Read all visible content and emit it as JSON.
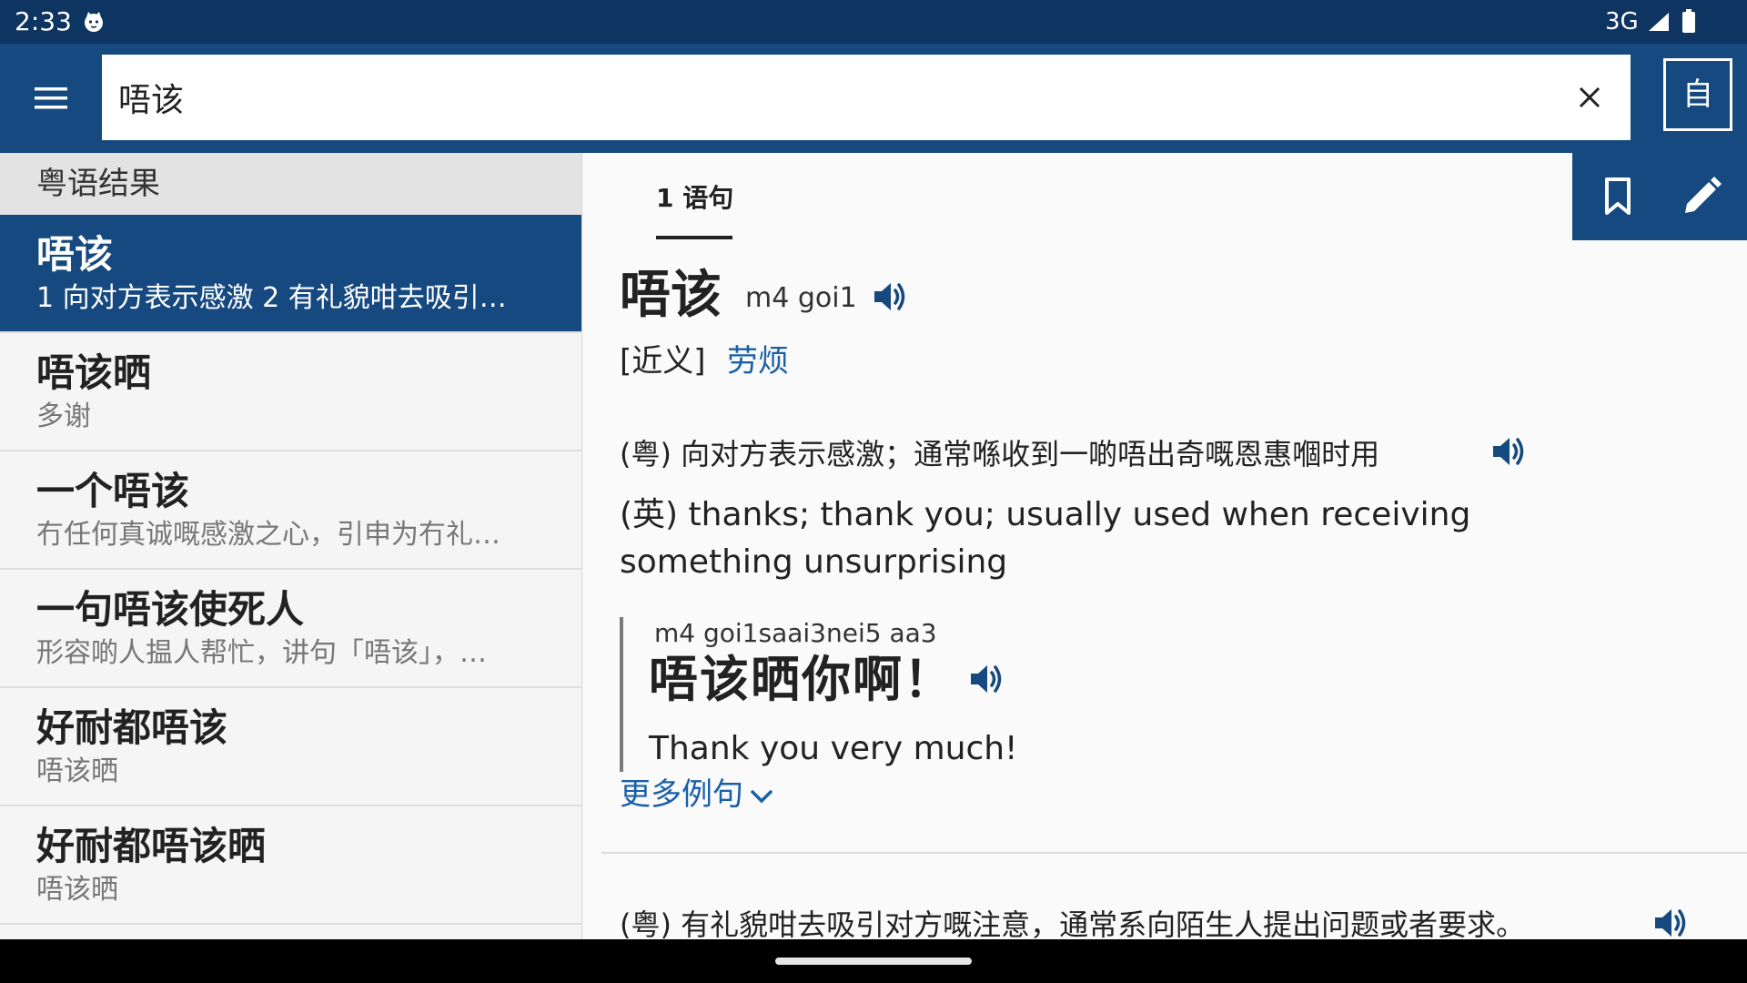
{
  "status_bar": {
    "time": "2:33",
    "network": "3G",
    "app_icon": "cat-face-icon",
    "signal_icon": "signal-icon",
    "battery_icon": "battery-icon"
  },
  "app_bar": {
    "menu_icon": "hamburger-menu-icon",
    "search_value": "唔该",
    "clear_icon": "close-icon",
    "mode_label": "自",
    "accent_color": "#15497f"
  },
  "results": {
    "header": "粤语结果",
    "items": [
      {
        "word": "唔该",
        "desc": "1 向对方表示感激 2 有礼貌咁去吸引…",
        "selected": true
      },
      {
        "word": "唔该晒",
        "desc": "多谢"
      },
      {
        "word": "一个唔该",
        "desc": "冇任何真诚嘅感激之心，引申为冇礼…"
      },
      {
        "word": "一句唔该使死人",
        "desc": "形容啲人揾人帮忙，讲句「唔该」，…"
      },
      {
        "word": "好耐都唔该",
        "desc": "唔该晒"
      },
      {
        "word": "好耐都唔该晒",
        "desc": "唔该晒"
      }
    ]
  },
  "entry": {
    "tab_label": "1 语句",
    "headword": "唔该",
    "jyutping": "m4 goi1",
    "synonym_label": "[近义]",
    "synonym": "劳烦",
    "definition_1": {
      "yue": "(粤) 向对方表示感激；通常喺收到一啲唔出奇嘅恩惠嗰时用",
      "eng": "(英) thanks; thank you; usually used when receiving something unsurprising"
    },
    "example": {
      "jyutping": "m4 goi1saai3nei5 aa3",
      "sentence": "唔该晒你啊！",
      "translation": "Thank you very much!"
    },
    "more_examples": "更多例句",
    "definition_2": {
      "yue": "(粤) 有礼貌咁去吸引对方嘅注意，通常系向陌生人提出问题或者要求。"
    },
    "link_color": "#1a5fa8"
  }
}
